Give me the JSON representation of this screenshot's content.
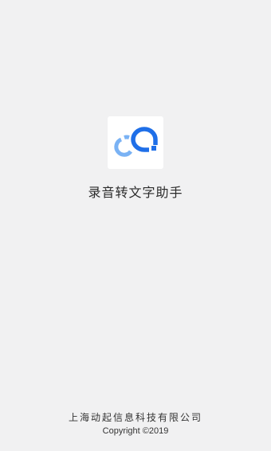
{
  "app": {
    "name": "录音转文字助手",
    "icon": "recorder-bubbles-logo-icon"
  },
  "footer": {
    "company": "上海动起信息科技有限公司",
    "copyright": "Copyright ©2019"
  },
  "colors": {
    "background": "#f1f1f2",
    "logo_light_blue": "#7ab2f4",
    "logo_dark_blue": "#1f6fe8"
  }
}
